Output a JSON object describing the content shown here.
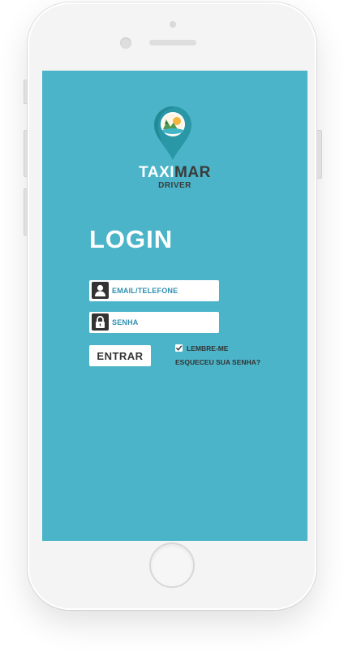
{
  "app": {
    "brand_part1": "TAXI",
    "brand_part2": "MAR",
    "subtitle": "DRIVER"
  },
  "login": {
    "title": "LOGIN",
    "email_placeholder": "EMAIL/TELEFONE",
    "password_placeholder": "SENHA",
    "submit_label": "ENTRAR",
    "remember_label": "LEMBRE-ME",
    "remember_checked": true,
    "forgot_label": "ESQUECEU SUA SENHA?"
  },
  "icons": {
    "logo": "map-pin-logo-icon",
    "email": "user-icon",
    "password": "lock-icon",
    "checkbox": "checkmark-icon"
  },
  "colors": {
    "screen_bg": "#4bb4c8",
    "pin": "#2a97a6",
    "brand_dark": "#3a3a3a",
    "field_text": "#2f8fb0",
    "icon_bg": "#333333"
  }
}
